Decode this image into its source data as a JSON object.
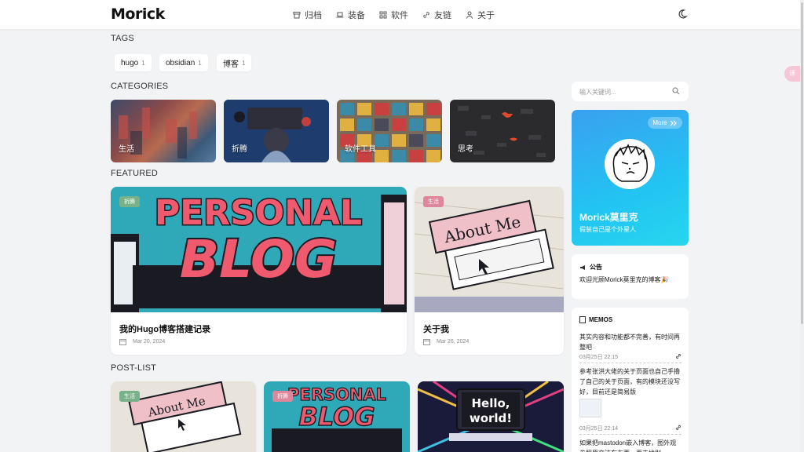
{
  "header": {
    "logo": "Morick",
    "nav": [
      {
        "label": "归档",
        "icon": "archive-icon"
      },
      {
        "label": "装备",
        "icon": "laptop-icon"
      },
      {
        "label": "软件",
        "icon": "grid-icon"
      },
      {
        "label": "友链",
        "icon": "link-icon"
      },
      {
        "label": "关于",
        "icon": "user-icon"
      }
    ],
    "theme_icon": "moon-icon"
  },
  "translate_label": "译",
  "sections": {
    "tags": "TAGS",
    "categories": "CATEGORIES",
    "featured": "FEATURED",
    "postlist": "POST-LIST"
  },
  "tags": [
    {
      "name": "hugo",
      "count": "1"
    },
    {
      "name": "obsidian",
      "count": "1"
    },
    {
      "name": "博客",
      "count": "1"
    }
  ],
  "categories": [
    "生活",
    "折腾",
    "软件工具",
    "思考"
  ],
  "featured": [
    {
      "badge": "折腾",
      "title": "我的Hugo博客搭建记录",
      "date": "Mar 20, 2024",
      "art": [
        "PERSONAL",
        "BLOG"
      ],
      "badge_color": "#79b28a"
    },
    {
      "badge": "生活",
      "title": "关于我",
      "date": "Mar 26, 2024",
      "art": [
        "About Me"
      ],
      "badge_color": "#e0869a"
    }
  ],
  "postlist": [
    {
      "badge": "生活",
      "art": "About Me"
    },
    {
      "badge": "折腾",
      "art": "PERSONAL BLOG"
    },
    {
      "badge": "",
      "art": "Hello, world!"
    }
  ],
  "sidebar": {
    "search_placeholder": "输入关键词...",
    "more": "More",
    "name": "Morick莫里克",
    "subtitle": "假装自己是个外星人",
    "announcement_title": "公告",
    "announcement_text": "欢迎光顾Morick莫里克的博客🎉",
    "memos_title": "MEMOS",
    "memos": [
      {
        "text": "其实内容和功能都不完善，有时间再整吧",
        "date": "03月25日 22:15"
      },
      {
        "text": "参考张洪大佬的关于页面也自己手撸了自己的关于页面，有的模块还没写好，目前还是简易版",
        "date": "03月25日 22:14"
      },
      {
        "text": "如果把mastodon嵌入博客，图外观参照原文该有东西，再去找别",
        "date": ""
      }
    ]
  },
  "colors": {
    "accent": "#22c4f2",
    "teal": "#2fa8b8",
    "coral": "#f05a6e"
  }
}
